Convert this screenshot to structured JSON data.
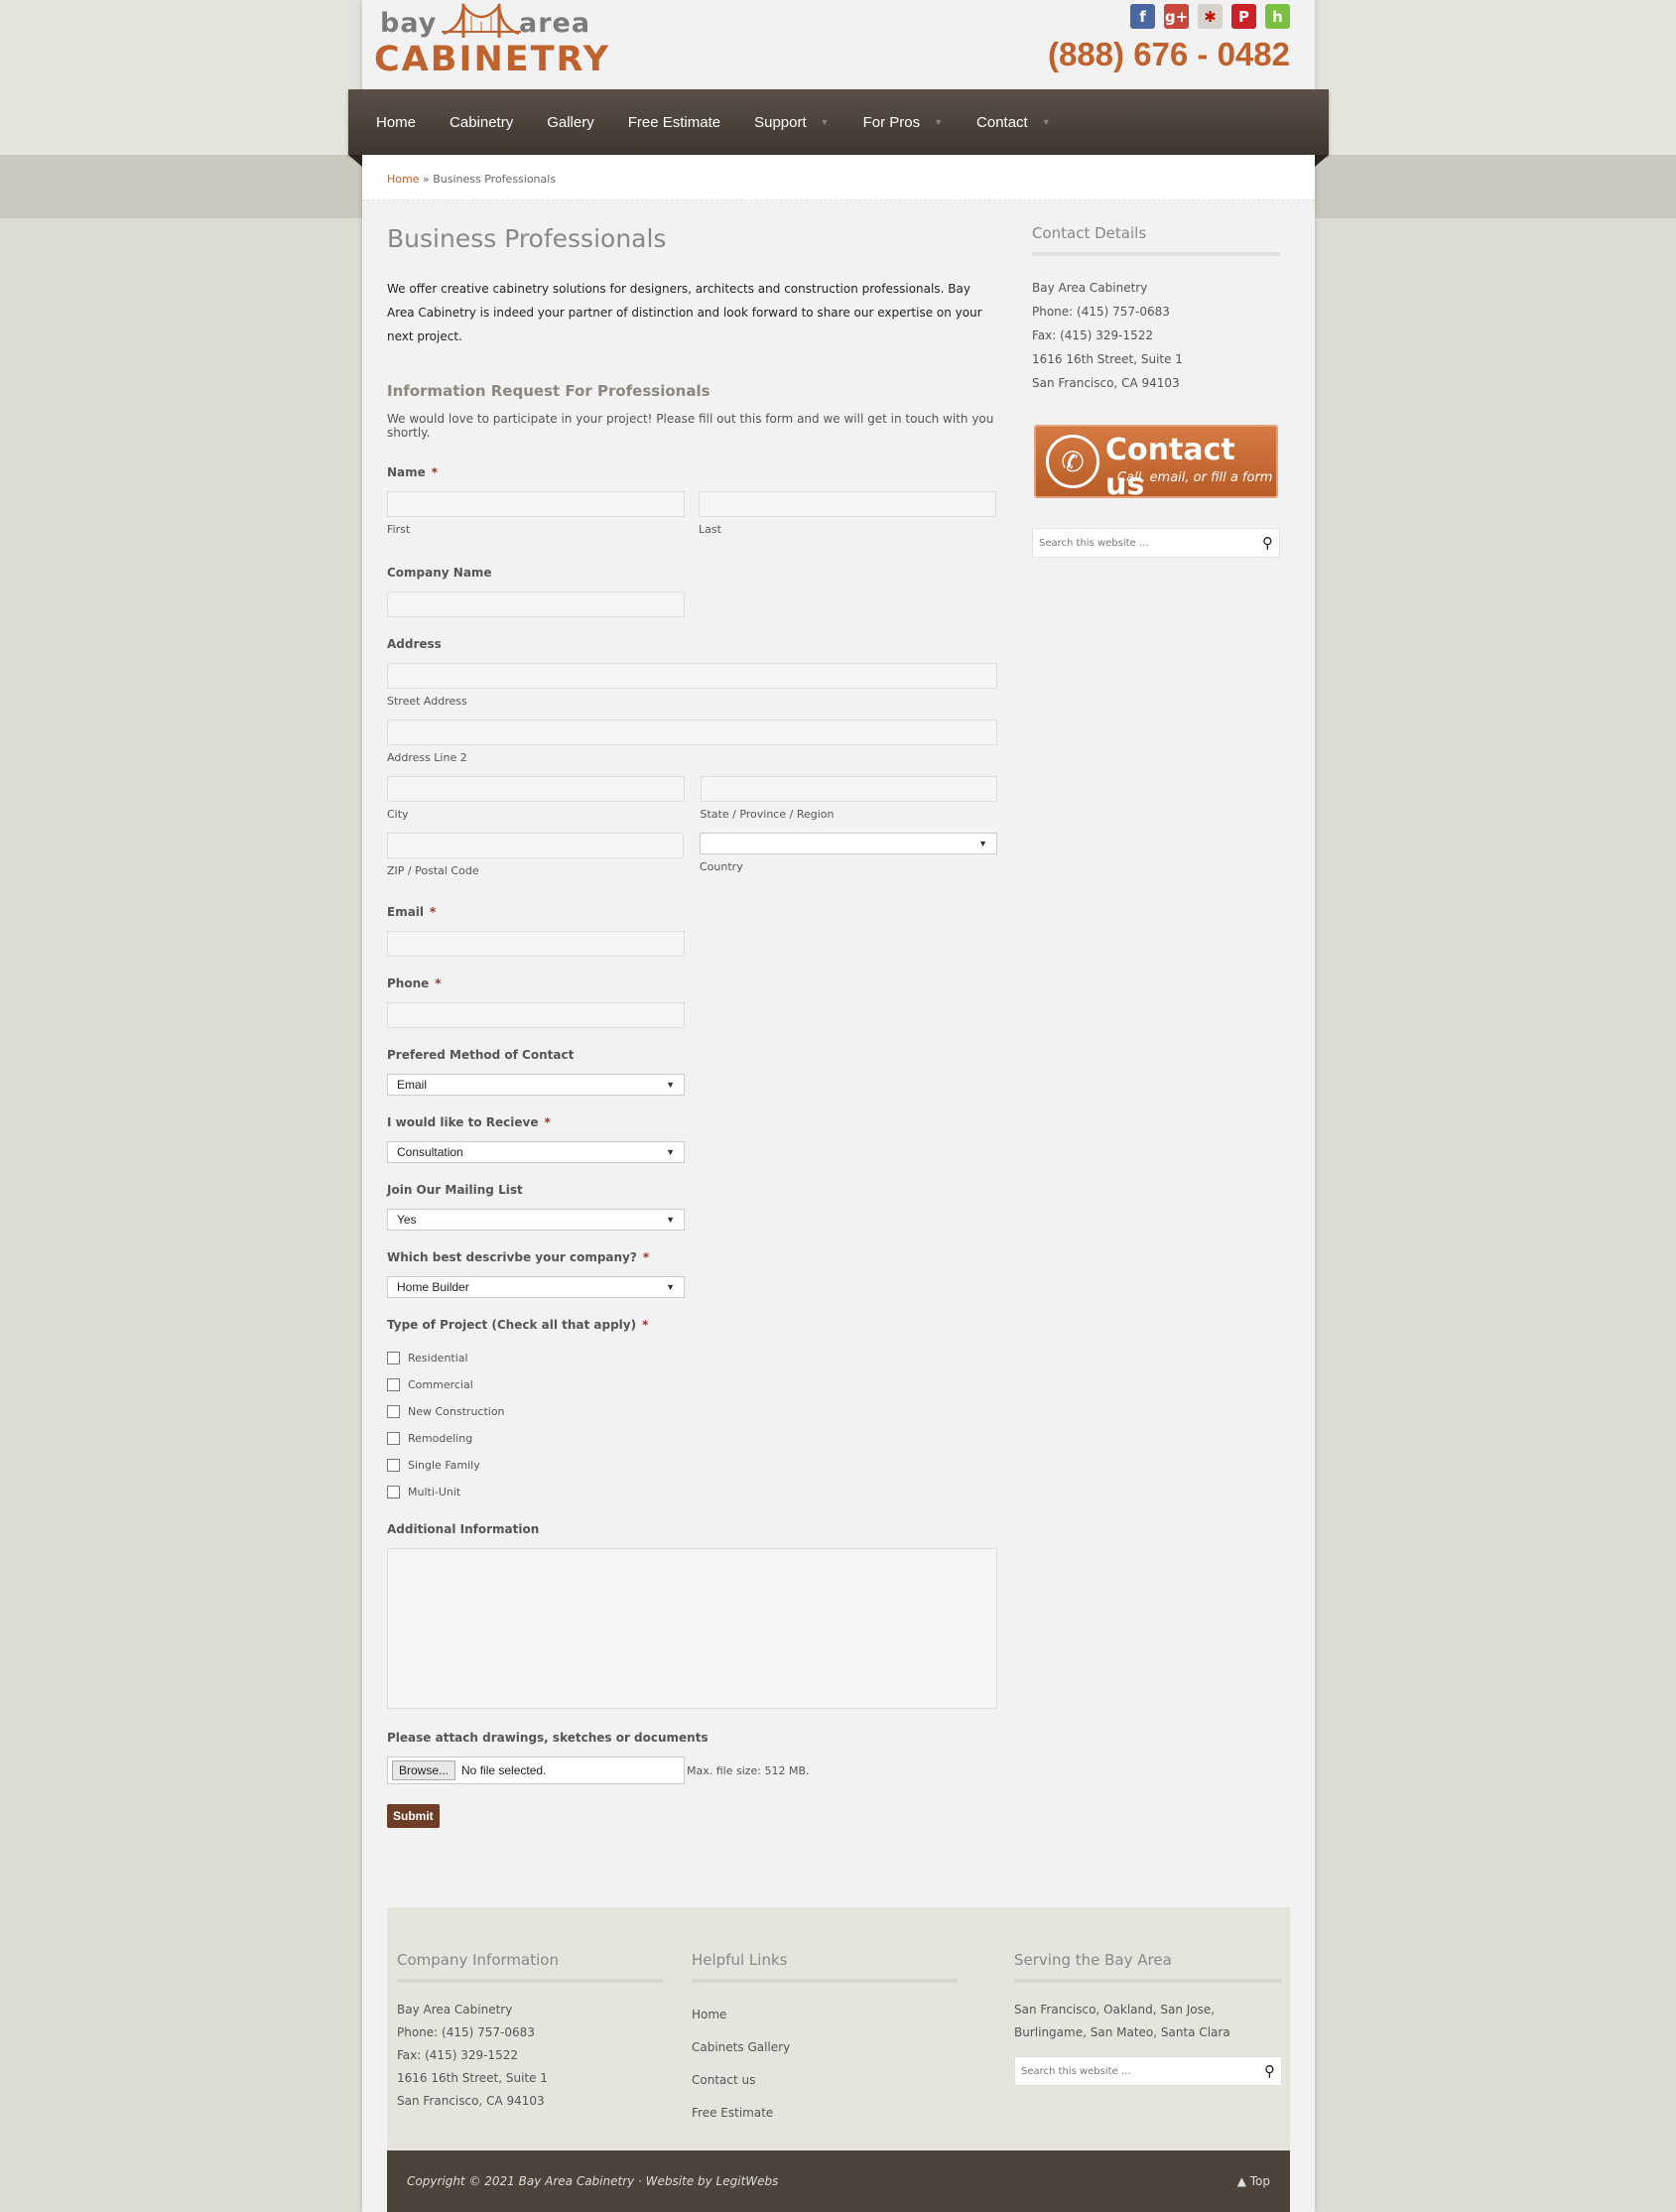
{
  "brand": {
    "logo_top_left": "bay",
    "logo_top_right": "area",
    "logo_bottom": "CABINETRY",
    "phone": "(888) 676 - 0482",
    "accent": "#c0622e"
  },
  "social": [
    {
      "name": "facebook-icon",
      "glyph": "f",
      "color": "#4b67a1"
    },
    {
      "name": "google-plus-icon",
      "glyph": "g+",
      "color": "#c8473c"
    },
    {
      "name": "yelp-icon",
      "glyph": "✱",
      "color": "#d6d3cf"
    },
    {
      "name": "pinterest-icon",
      "glyph": "P",
      "color": "#cb2027"
    },
    {
      "name": "houzz-icon",
      "glyph": "h",
      "color": "#7ac142"
    }
  ],
  "nav": [
    {
      "label": "Home",
      "dropdown": false
    },
    {
      "label": "Cabinetry",
      "dropdown": false
    },
    {
      "label": "Gallery",
      "dropdown": false
    },
    {
      "label": "Free Estimate",
      "dropdown": false
    },
    {
      "label": "Support",
      "dropdown": true
    },
    {
      "label": "For Pros",
      "dropdown": true
    },
    {
      "label": "Contact",
      "dropdown": true
    }
  ],
  "breadcrumb": {
    "home": "Home",
    "sep": " » ",
    "current": "Business Professionals"
  },
  "page": {
    "title": "Business Professionals",
    "intro": "We offer creative cabinetry solutions for designers, architects and construction professionals. Bay Area Cabinetry is indeed your partner of distinction and look forward to share our expertise on your next project."
  },
  "form": {
    "title": "Information Request For Professionals",
    "subtitle": "We would love to participate in your project! Please fill out this form and we will get in touch with you shortly.",
    "required_mark": "*",
    "name_label": "Name",
    "first": "First",
    "last": "Last",
    "company_label": "Company Name",
    "address_label": "Address",
    "street": "Street Address",
    "line2": "Address Line 2",
    "city": "City",
    "state": "State / Province / Region",
    "zip": "ZIP / Postal Code",
    "country": "Country",
    "email_label": "Email",
    "phone_label": "Phone",
    "contact_method_label": "Prefered Method of Contact",
    "contact_method_value": "Email",
    "receive_label": "I would like to Recieve",
    "receive_value": "Consultation",
    "mailing_label": "Join Our Mailing List",
    "mailing_value": "Yes",
    "company_type_label": "Which best descrivbe your company?",
    "company_type_value": "Home Builder",
    "project_label": "Type of Project (Check all that apply)",
    "project_options": [
      "Residential",
      "Commercial",
      "New Construction",
      "Remodeling",
      "Single Family",
      "Multi-Unit"
    ],
    "additional_label": "Additional Information",
    "attach_label": "Please attach drawings, sketches or documents",
    "browse": "Browse...",
    "no_file": "No file selected.",
    "max_size": "Max. file size: 512 MB.",
    "submit": "Submit"
  },
  "sidebar": {
    "title": "Contact Details",
    "lines": [
      "Bay Area Cabinetry",
      "Phone: (415) 757-0683",
      "Fax: (415) 329-1522",
      "1616 16th Street, Suite 1",
      "San Francisco, CA 94103"
    ],
    "cta_title": "Contact us",
    "cta_sub": "Call, email, or fill a form",
    "search_placeholder": "Search this website …"
  },
  "footer": {
    "company_title": "Company Information",
    "company_lines": [
      "Bay Area Cabinetry",
      "Phone: (415) 757-0683",
      "Fax: (415) 329-1522",
      "1616 16th Street, Suite 1",
      "San Francisco, CA 94103"
    ],
    "links_title": "Helpful Links",
    "links": [
      "Home",
      "Cabinets Gallery",
      "Contact us",
      "Free Estimate"
    ],
    "serving_title": "Serving the Bay Area",
    "serving_text": "San Francisco, Oakland, San Jose, Burlingame, San Mateo, Santa Clara",
    "search_placeholder": "Search this website …",
    "copyright": "Copyright © 2021 Bay Area Cabinetry · Website by LegitWebs",
    "top": "Top"
  }
}
